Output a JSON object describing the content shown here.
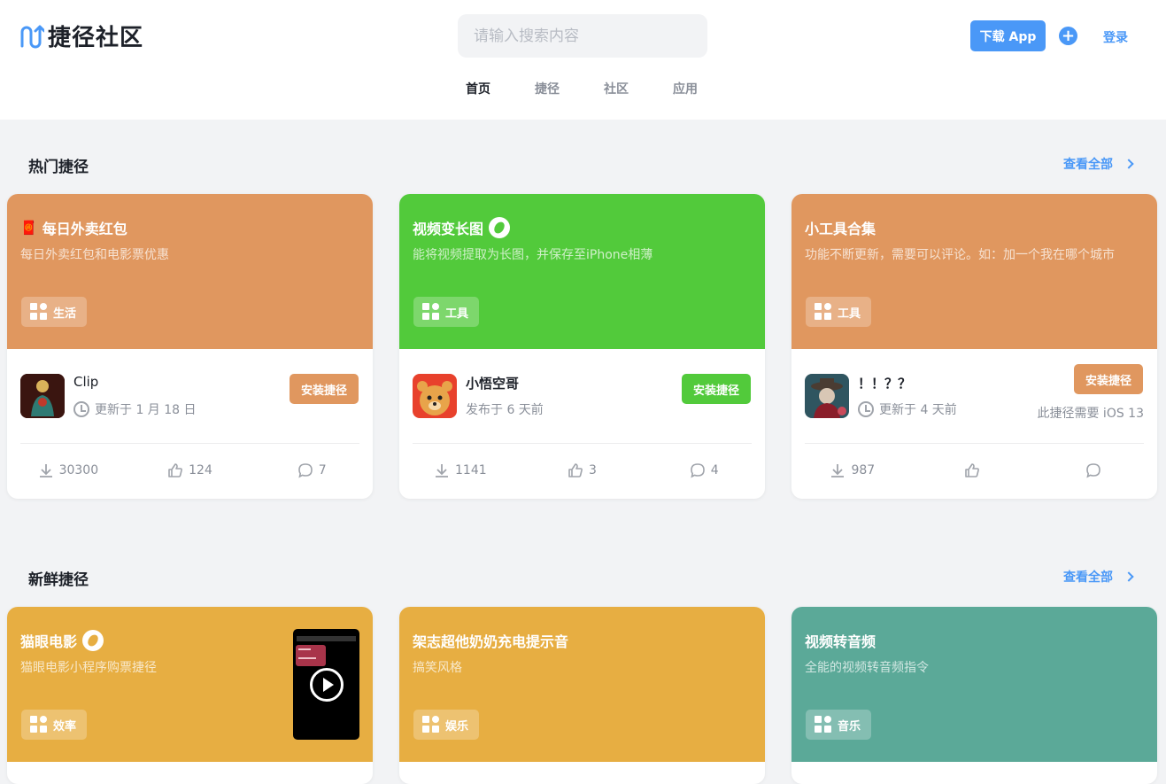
{
  "header": {
    "logo_text": "捷径社区",
    "search_placeholder": "请输入搜索内容",
    "download_label": "下载 App",
    "plus_label": "+",
    "login_label": "登录"
  },
  "nav": [
    {
      "label": "首页",
      "active": true
    },
    {
      "label": "捷径",
      "active": false
    },
    {
      "label": "社区",
      "active": false
    },
    {
      "label": "应用",
      "active": false
    }
  ],
  "hot": {
    "title": "热门捷径",
    "view_all": "查看全部",
    "cards": [
      {
        "title_emoji": "🧧",
        "title": "每日外卖红包",
        "desc": "每日外卖红包和电影票优惠",
        "tag": "生活",
        "color": "#e0975f",
        "author": "Clip",
        "update": "更新于 1 月 18 日",
        "install": "安装捷径",
        "downloads": "30300",
        "likes": "124",
        "comments": "7"
      },
      {
        "title": "视频变长图",
        "desc": "能将视频提取为长图，并保存至iPhone相薄",
        "tag": "工具",
        "color": "#52ca3b",
        "author": "小悟空哥",
        "update": "发布于 6 天前",
        "install": "安装捷径",
        "downloads": "1141",
        "likes": "3",
        "comments": "4"
      },
      {
        "title": "小工具合集",
        "desc": "功能不断更新，需要可以评论。如：加一个我在哪个城市",
        "tag": "工具",
        "color": "#e0975f",
        "author": "！！？？",
        "update": "更新于 4 天前",
        "install": "安装捷径",
        "require": "此捷径需要 iOS 13",
        "downloads": "987",
        "likes": "",
        "comments": ""
      }
    ]
  },
  "fresh": {
    "title": "新鲜捷径",
    "view_all": "查看全部",
    "cards": [
      {
        "title": "猫眼电影",
        "desc": "猫眼电影小程序购票捷径",
        "tag": "效率",
        "color": "#e7ae42"
      },
      {
        "title": "架志超他奶奶充电提示音",
        "desc": "搞笑风格",
        "tag": "娱乐",
        "color": "#e7ae42"
      },
      {
        "title": "视频转音频",
        "desc": "全能的视频转音频指令",
        "tag": "音乐",
        "color": "#5ba998"
      }
    ]
  }
}
